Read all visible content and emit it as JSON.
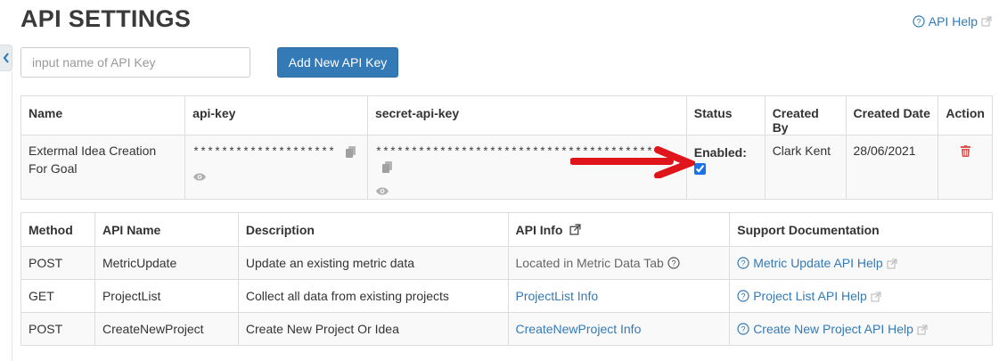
{
  "header": {
    "title": "API SETTINGS",
    "help_label": "API Help"
  },
  "key_form": {
    "placeholder": "input name of API Key",
    "add_button": "Add New API Key"
  },
  "keys_table": {
    "headers": [
      "Name",
      "api-key",
      "secret-api-key",
      "Status",
      "Created By",
      "Created Date",
      "Action"
    ],
    "rows": [
      {
        "name": "Extermal Idea Creation For Goal",
        "api_key": "********************",
        "secret_key": "****************************************",
        "status_label": "Enabled:",
        "enabled": true,
        "created_by": "Clark Kent",
        "created_date": "28/06/2021"
      }
    ]
  },
  "api_table": {
    "headers": [
      "Method",
      "API Name",
      "Description",
      "API Info",
      "Support Documentation"
    ],
    "rows": [
      {
        "method": "POST",
        "name": "MetricUpdate",
        "description": "Update an existing metric data",
        "info": "Located in Metric Data Tab",
        "doc": "Metric Update API Help"
      },
      {
        "method": "GET",
        "name": "ProjectList",
        "description": "Collect all data from existing projects",
        "info": "ProjectList Info",
        "doc": "Project List API Help"
      },
      {
        "method": "POST",
        "name": "CreateNewProject",
        "description": "Create New Project Or Idea",
        "info": "CreateNewProject Info",
        "doc": "Create New Project API Help"
      }
    ]
  },
  "colors": {
    "primary": "#337ab7",
    "danger": "#d9534f",
    "annotation_arrow": "#e0151b"
  },
  "icons": [
    "chevron-left-icon",
    "question-circle-icon",
    "external-link-icon",
    "copy-icon",
    "eye-icon",
    "trash-icon",
    "arrow-annotation"
  ]
}
